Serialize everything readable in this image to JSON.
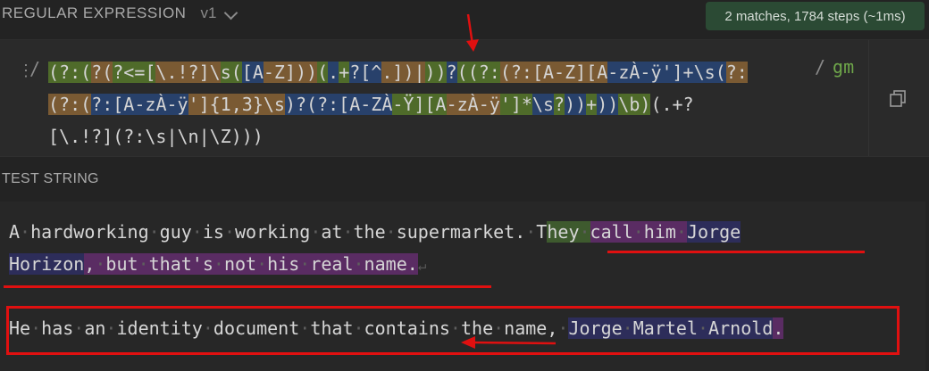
{
  "header": {
    "title": "REGULAR EXPRESSION",
    "version": "v1",
    "status": "2 matches, 1784 steps (~1ms)"
  },
  "regex": {
    "delimiter_open": "/",
    "delimiter_close": "/",
    "flags": "gm",
    "pattern": "(?:(?(?<=[\\.!?]\\s([A-Z]))(.+?[^.])|))?((?:(?:[A-Z][A-zÀ-ÿ']+\\s(?:(?:(?:[A-zÀ-ÿ']{1,3}\\s)?(?:[A-ZÀ-Ÿ][A-zÀ-ÿ']*\\s?))+))\\b)(.+?[\\.!?](?:\\s|\\n|\\Z)))"
  },
  "test_string": {
    "title": "TEST STRING",
    "lines": [
      "A hardworking guy is working at the supermarket. They call him Jorge",
      "Horizon, but that's not his real name.",
      "He has an identity document that contains the name, Jorge Martel Arnold."
    ]
  },
  "colors": {
    "group_green": "#4f6b2a",
    "group_blue": "#28416b",
    "group_orange": "#7a5a33",
    "annotation_red": "#e01010"
  }
}
